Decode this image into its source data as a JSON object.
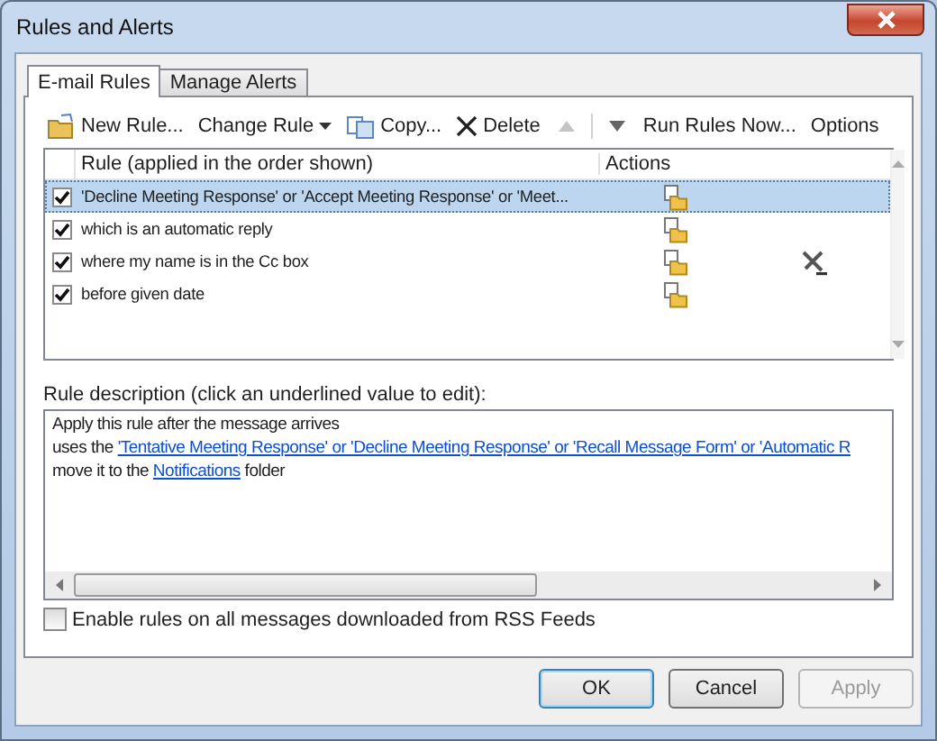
{
  "window": {
    "title": "Rules and Alerts"
  },
  "tabs": [
    {
      "label": "E-mail Rules",
      "selected": true
    },
    {
      "label": "Manage Alerts",
      "selected": false
    }
  ],
  "toolbar": [
    {
      "kind": "new",
      "label": "New Rule...",
      "disabled": false
    },
    {
      "kind": "dropdown",
      "label": "Change Rule",
      "disabled": false
    },
    {
      "kind": "copy",
      "label": "Copy...",
      "disabled": false
    },
    {
      "kind": "delete",
      "label": "Delete",
      "disabled": false
    },
    {
      "kind": "up",
      "disabled": true
    },
    {
      "kind": "down",
      "disabled": false
    },
    {
      "kind": "text",
      "label": "Run Rules Now...",
      "disabled": false
    },
    {
      "kind": "text",
      "label": "Options",
      "disabled": false
    }
  ],
  "rules": {
    "columns": [
      "Rule (applied in the order shown)",
      "Actions"
    ],
    "rows": [
      {
        "text": "'Decline Meeting Response' or 'Accept Meeting Response' or 'Meet...",
        "checked": true,
        "selected": true,
        "advanced": false
      },
      {
        "text": "which is an automatic reply",
        "checked": true,
        "selected": false,
        "advanced": false
      },
      {
        "text": "where my name is in the Cc box",
        "checked": true,
        "selected": false,
        "advanced": true
      },
      {
        "text": "before given date",
        "checked": true,
        "selected": false,
        "advanced": false
      }
    ]
  },
  "description": {
    "label": "Rule description (click an underlined value to edit):",
    "lines": [
      [
        {
          "kind": "text",
          "text": "Apply this rule after the message arrives"
        }
      ],
      [
        {
          "kind": "text",
          "text": "uses the "
        },
        {
          "kind": "link",
          "text": "'Tentative Meeting Response' or 'Decline Meeting Response' or 'Recall Message Form' or 'Automatic R"
        }
      ],
      [
        {
          "kind": "text",
          "text": "move it to the "
        },
        {
          "kind": "link",
          "text": "Notifications"
        },
        {
          "kind": "text",
          "text": " folder"
        }
      ]
    ]
  },
  "rss_option": {
    "label": "Enable rules on all messages downloaded from RSS Feeds",
    "checked": false
  },
  "buttons": [
    {
      "label": "OK",
      "default": true,
      "disabled": false
    },
    {
      "label": "Cancel",
      "default": false,
      "disabled": false
    },
    {
      "label": "Apply",
      "default": false,
      "disabled": true
    }
  ]
}
